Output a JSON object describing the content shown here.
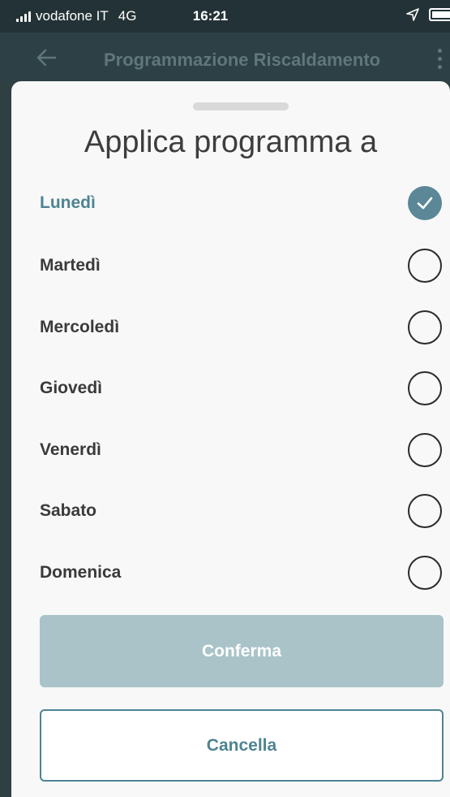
{
  "status_bar": {
    "carrier": "vodafone IT",
    "network": "4G",
    "time": "16:21"
  },
  "app_bar": {
    "title": "Programmazione Riscaldamento"
  },
  "sheet": {
    "title": "Applica programma a",
    "days": [
      {
        "label": "Lunedì",
        "checked": true
      },
      {
        "label": "Martedì",
        "checked": false
      },
      {
        "label": "Mercoledì",
        "checked": false
      },
      {
        "label": "Giovedì",
        "checked": false
      },
      {
        "label": "Venerdì",
        "checked": false
      },
      {
        "label": "Sabato",
        "checked": false
      },
      {
        "label": "Domenica",
        "checked": false
      }
    ],
    "confirm_label": "Conferma",
    "cancel_label": "Cancella"
  },
  "colors": {
    "accent": "#4f8393",
    "confirm_button": "#a9c3c9",
    "app_bar": "#2c4045",
    "status_bar": "#233236"
  }
}
